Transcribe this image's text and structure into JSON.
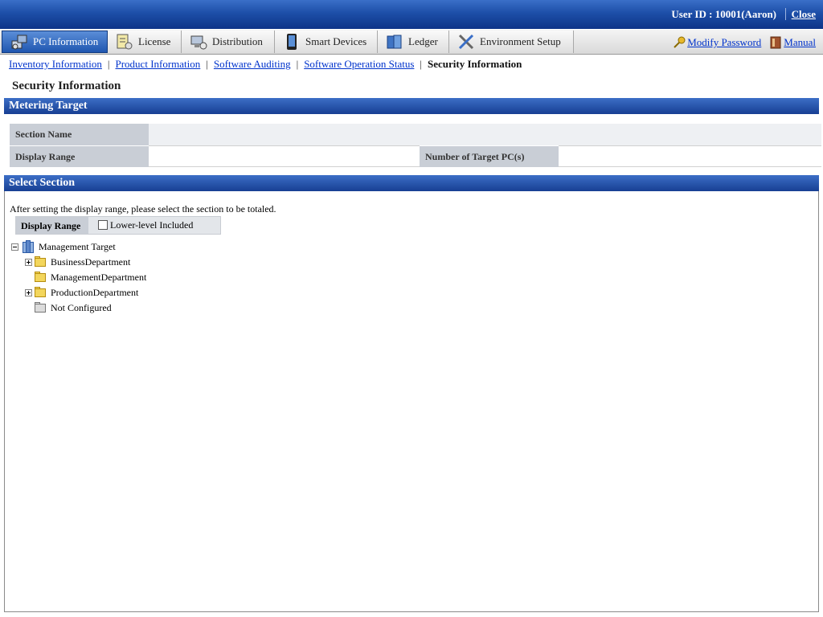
{
  "header": {
    "user_label": "User ID :",
    "user_value": "10001(Aaron)",
    "close_label": "Close"
  },
  "tabs": [
    {
      "label": "PC Information",
      "icon": "pc-info-icon",
      "active": true
    },
    {
      "label": "License",
      "icon": "license-icon",
      "active": false
    },
    {
      "label": "Distribution",
      "icon": "distribution-icon",
      "active": false
    },
    {
      "label": "Smart Devices",
      "icon": "smart-device-icon",
      "active": false
    },
    {
      "label": "Ledger",
      "icon": "ledger-icon",
      "active": false
    },
    {
      "label": "Environment Setup",
      "icon": "tools-icon",
      "active": false
    }
  ],
  "right_links": {
    "modify_password": "Modify Password",
    "manual": "Manual"
  },
  "subnav": {
    "items": [
      "Inventory Information",
      "Product Information",
      "Software Auditing",
      "Software Operation Status"
    ],
    "current": "Security Information"
  },
  "page_title": "Security Information",
  "metering": {
    "title": "Metering Target",
    "section_name_label": "Section Name",
    "section_name_value": "",
    "display_range_label": "Display Range",
    "display_range_value": "",
    "target_pc_label": "Number of Target PC(s)",
    "target_pc_value": ""
  },
  "select_section": {
    "title": "Select Section",
    "instruction": "After setting the display range, please select the section to be totaled.",
    "display_range_label": "Display Range",
    "lower_level_label": "Lower-level Included",
    "lower_level_checked": false
  },
  "tree": {
    "root": "Management Target",
    "children": [
      {
        "label": "BusinessDepartment",
        "expandable": true
      },
      {
        "label": "ManagementDepartment",
        "expandable": false
      },
      {
        "label": "ProductionDepartment",
        "expandable": true
      },
      {
        "label": "Not Configured",
        "expandable": false
      }
    ]
  },
  "colors": {
    "header_blue": "#1d4fa8",
    "link_blue": "#0033cc",
    "label_gray": "#c9ced6"
  }
}
